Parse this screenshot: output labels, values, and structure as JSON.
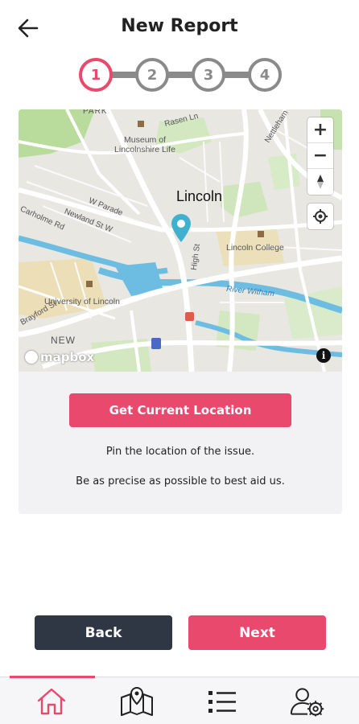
{
  "header": {
    "title": "New Report",
    "back_icon": "arrow-left-icon"
  },
  "stepper": {
    "steps": [
      "1",
      "2",
      "3",
      "4"
    ],
    "active": 1
  },
  "map": {
    "city": "Lincoln",
    "pois": {
      "museum": "Museum of\nLincolnshire Life",
      "college": "Lincoln College",
      "university": "University of Lincoln"
    },
    "streets": {
      "rasen": "Rasen Ln",
      "nettleham": "Nettleham",
      "w_parade": "W Parade",
      "newland": "Newland St W",
      "carholme": "Carholme Rd",
      "high_st": "High St",
      "river": "River Witham",
      "new": "NEW",
      "park": "PARK",
      "brayford": "Brayford St"
    },
    "zoom_in": "+",
    "zoom_out": "−",
    "compass": "▲",
    "attribution": "mapbox",
    "info": "i"
  },
  "location": {
    "button_label": "Get Current Location",
    "help_line_1": "Pin the location of the issue.",
    "help_line_2": "Be as precise as possible to best aid us."
  },
  "actions": {
    "back_label": "Back",
    "next_label": "Next"
  },
  "tabbar": {
    "tabs": [
      "home-icon",
      "map-icon",
      "list-icon",
      "user-settings-icon"
    ],
    "active": 0
  },
  "colors": {
    "accent": "#e8496c",
    "dark_button": "#2f3744",
    "inactive_step": "#8a8a8a"
  }
}
